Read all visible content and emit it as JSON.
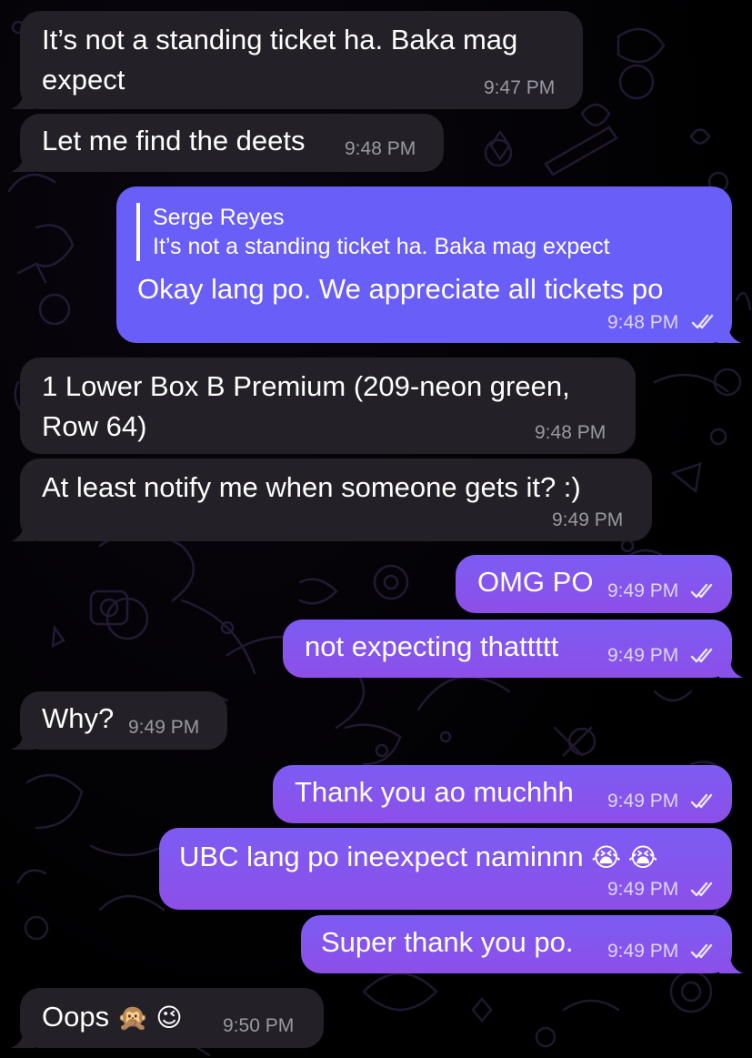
{
  "colors": {
    "incoming_bubble": "#232127",
    "outgoing_bubble": "#8055ee",
    "reply_bubble": "#6a5ef8",
    "background": "#000000"
  },
  "messages": [
    {
      "direction": "in",
      "text_line1": "It’s not a standing ticket ha. Baka mag",
      "text_line2": "expect",
      "time": "9:47 PM"
    },
    {
      "direction": "in",
      "text": "Let me find the deets",
      "time": "9:48 PM"
    },
    {
      "direction": "out",
      "reply_to_name": "Serge Reyes",
      "reply_to_text": "It’s not a standing ticket ha. Baka mag expect",
      "text": "Okay lang po. We appreciate all tickets po",
      "time": "9:48 PM",
      "status": "read"
    },
    {
      "direction": "in",
      "text_line1": "1 Lower Box B Premium (209-neon green,",
      "text_line2": "Row 64)",
      "time": "9:48 PM"
    },
    {
      "direction": "in",
      "text": "At least notify me when someone gets it? :)",
      "time": "9:49 PM"
    },
    {
      "direction": "out",
      "text": "OMG PO",
      "time": "9:49 PM",
      "status": "read"
    },
    {
      "direction": "out",
      "text": "not expecting thattttt",
      "time": "9:49 PM",
      "status": "read"
    },
    {
      "direction": "in",
      "text": "Why?",
      "time": "9:49 PM"
    },
    {
      "direction": "out",
      "text": "Thank you ao muchhh",
      "time": "9:49 PM",
      "status": "read"
    },
    {
      "direction": "out",
      "text": "UBC lang po ineexpect naminnn",
      "emoji": "😭 😭",
      "time": "9:49 PM",
      "status": "read"
    },
    {
      "direction": "out",
      "text": "Super thank you po.",
      "time": "9:49 PM",
      "status": "read"
    },
    {
      "direction": "in",
      "text": "Oops",
      "emoji": "🙊 😉",
      "time": "9:50 PM"
    }
  ]
}
